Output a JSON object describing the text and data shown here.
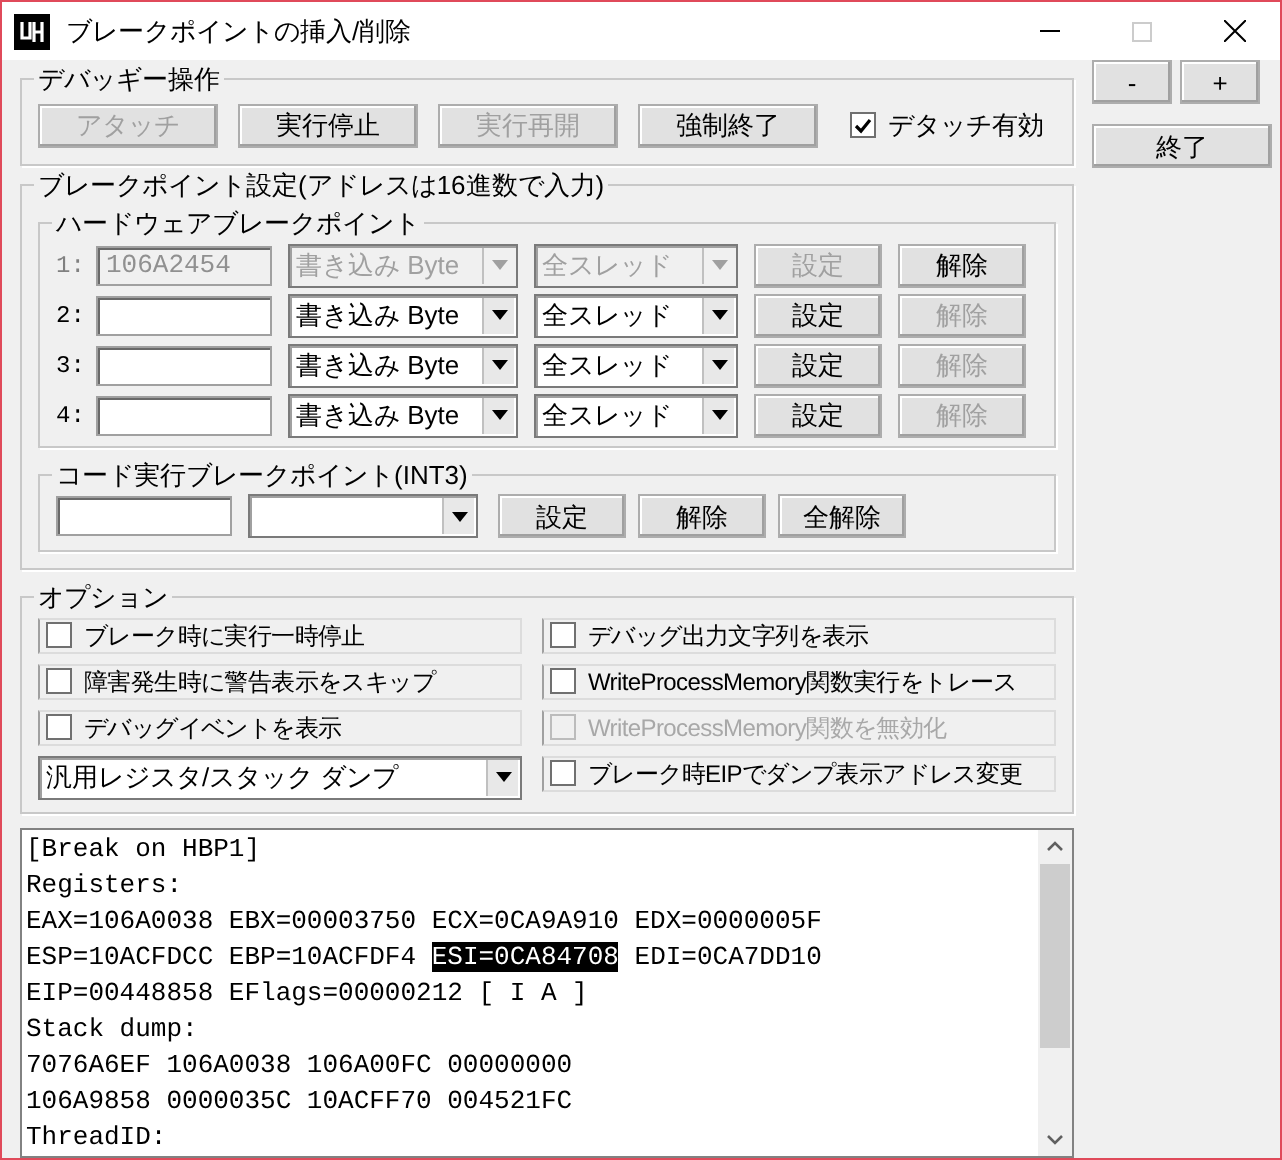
{
  "window": {
    "title": "ブレークポイントの挿入/削除"
  },
  "side_buttons": [
    {
      "label": "-"
    },
    {
      "label": "+"
    }
  ],
  "exit_button": {
    "label": "終了"
  },
  "debuggee": {
    "title": "デバッギー操作",
    "buttons": [
      {
        "label": "アタッチ",
        "disabled": true
      },
      {
        "label": "実行停止",
        "disabled": false
      },
      {
        "label": "実行再開",
        "disabled": true
      },
      {
        "label": "強制終了",
        "disabled": false
      }
    ],
    "detach": {
      "label": "デタッチ有効",
      "checked": true
    }
  },
  "breakpoints": {
    "title": "ブレークポイント設定(アドレスは16進数で入力)",
    "hardware": {
      "title": "ハードウェアブレークポイント",
      "rows": [
        {
          "label": "1:",
          "address": "106A2454",
          "access": "書き込み Byte",
          "thread": "全スレッド",
          "set_label": "設定",
          "clear_label": "解除",
          "locked": true,
          "clear_disabled": false
        },
        {
          "label": "2:",
          "access": "書き込み Byte",
          "thread": "全スレッド",
          "set_label": "設定",
          "clear_label": "解除",
          "locked": false,
          "clear_disabled": true
        },
        {
          "label": "3:",
          "access": "書き込み Byte",
          "thread": "全スレッド",
          "set_label": "設定",
          "clear_label": "解除",
          "locked": false,
          "clear_disabled": true
        },
        {
          "label": "4:",
          "access": "書き込み Byte",
          "thread": "全スレッド",
          "set_label": "設定",
          "clear_label": "解除",
          "locked": false,
          "clear_disabled": true
        }
      ]
    },
    "code": {
      "title": "コード実行ブレークポイント(INT3)",
      "buttons": [
        {
          "label": "設定"
        },
        {
          "label": "解除"
        },
        {
          "label": "全解除"
        }
      ]
    }
  },
  "options": {
    "title": "オプション",
    "left": [
      {
        "kind": "checkbox",
        "label": "ブレーク時に実行一時停止",
        "checked": false,
        "disabled": false
      },
      {
        "kind": "checkbox",
        "label": "障害発生時に警告表示をスキップ",
        "checked": false,
        "disabled": false
      },
      {
        "kind": "checkbox",
        "label": "デバッグイベントを表示",
        "checked": false,
        "disabled": false
      },
      {
        "kind": "dropdown",
        "label": "汎用レジスタ/スタック ダンプ"
      }
    ],
    "right": [
      {
        "kind": "checkbox",
        "label": "デバッグ出力文字列を表示",
        "checked": false,
        "disabled": false
      },
      {
        "kind": "checkbox",
        "label": "WriteProcessMemory関数実行をトレース",
        "checked": false,
        "disabled": false
      },
      {
        "kind": "checkbox",
        "label": "WriteProcessMemory関数を無効化",
        "checked": false,
        "disabled": true
      },
      {
        "kind": "checkbox",
        "label": "ブレーク時EIPでダンプ表示アドレス変更",
        "checked": false,
        "disabled": false
      }
    ]
  },
  "log": {
    "lines": [
      {
        "parts": [
          {
            "text": "[Break on HBP1]",
            "selected": false
          }
        ]
      },
      {
        "parts": [
          {
            "text": "Registers:",
            "selected": false
          }
        ]
      },
      {
        "parts": [
          {
            "text": "EAX=106A0038 EBX=00003750 ECX=0CA9A910 EDX=0000005F",
            "selected": false
          }
        ]
      },
      {
        "parts": [
          {
            "text": "ESP=10ACFDCC EBP=10ACFDF4 ",
            "selected": false
          },
          {
            "text": "ESI=0CA84708",
            "selected": true
          },
          {
            "text": " EDI=0CA7DD10",
            "selected": false
          }
        ]
      },
      {
        "parts": [
          {
            "text": "EIP=00448858 EFlags=00000212 [ I A ]",
            "selected": false
          }
        ]
      },
      {
        "parts": [
          {
            "text": "Stack dump:",
            "selected": false
          }
        ]
      },
      {
        "parts": [
          {
            "text": "7076A6EF 106A0038 106A00FC 00000000",
            "selected": false
          }
        ]
      },
      {
        "parts": [
          {
            "text": "106A9858 0000035C 10ACFF70 004521FC",
            "selected": false
          }
        ]
      },
      {
        "parts": [
          {
            "text": "ThreadID:",
            "selected": false
          }
        ]
      }
    ]
  }
}
